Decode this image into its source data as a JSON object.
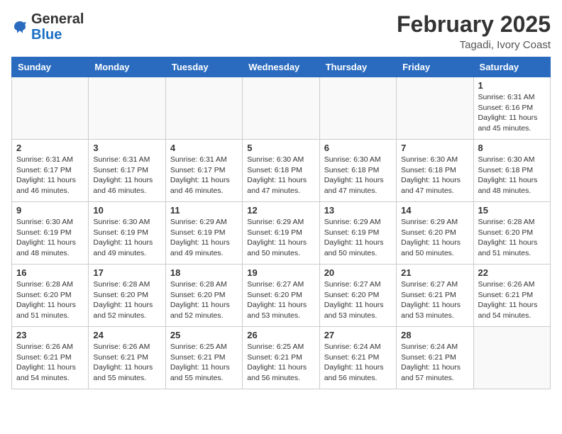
{
  "logo": {
    "general": "General",
    "blue": "Blue"
  },
  "title": {
    "month_year": "February 2025",
    "location": "Tagadi, Ivory Coast"
  },
  "days_of_week": [
    "Sunday",
    "Monday",
    "Tuesday",
    "Wednesday",
    "Thursday",
    "Friday",
    "Saturday"
  ],
  "weeks": [
    [
      {
        "day": "",
        "info": ""
      },
      {
        "day": "",
        "info": ""
      },
      {
        "day": "",
        "info": ""
      },
      {
        "day": "",
        "info": ""
      },
      {
        "day": "",
        "info": ""
      },
      {
        "day": "",
        "info": ""
      },
      {
        "day": "1",
        "info": "Sunrise: 6:31 AM\nSunset: 6:16 PM\nDaylight: 11 hours and 45 minutes."
      }
    ],
    [
      {
        "day": "2",
        "info": "Sunrise: 6:31 AM\nSunset: 6:17 PM\nDaylight: 11 hours and 46 minutes."
      },
      {
        "day": "3",
        "info": "Sunrise: 6:31 AM\nSunset: 6:17 PM\nDaylight: 11 hours and 46 minutes."
      },
      {
        "day": "4",
        "info": "Sunrise: 6:31 AM\nSunset: 6:17 PM\nDaylight: 11 hours and 46 minutes."
      },
      {
        "day": "5",
        "info": "Sunrise: 6:30 AM\nSunset: 6:18 PM\nDaylight: 11 hours and 47 minutes."
      },
      {
        "day": "6",
        "info": "Sunrise: 6:30 AM\nSunset: 6:18 PM\nDaylight: 11 hours and 47 minutes."
      },
      {
        "day": "7",
        "info": "Sunrise: 6:30 AM\nSunset: 6:18 PM\nDaylight: 11 hours and 47 minutes."
      },
      {
        "day": "8",
        "info": "Sunrise: 6:30 AM\nSunset: 6:18 PM\nDaylight: 11 hours and 48 minutes."
      }
    ],
    [
      {
        "day": "9",
        "info": "Sunrise: 6:30 AM\nSunset: 6:19 PM\nDaylight: 11 hours and 48 minutes."
      },
      {
        "day": "10",
        "info": "Sunrise: 6:30 AM\nSunset: 6:19 PM\nDaylight: 11 hours and 49 minutes."
      },
      {
        "day": "11",
        "info": "Sunrise: 6:29 AM\nSunset: 6:19 PM\nDaylight: 11 hours and 49 minutes."
      },
      {
        "day": "12",
        "info": "Sunrise: 6:29 AM\nSunset: 6:19 PM\nDaylight: 11 hours and 50 minutes."
      },
      {
        "day": "13",
        "info": "Sunrise: 6:29 AM\nSunset: 6:19 PM\nDaylight: 11 hours and 50 minutes."
      },
      {
        "day": "14",
        "info": "Sunrise: 6:29 AM\nSunset: 6:20 PM\nDaylight: 11 hours and 50 minutes."
      },
      {
        "day": "15",
        "info": "Sunrise: 6:28 AM\nSunset: 6:20 PM\nDaylight: 11 hours and 51 minutes."
      }
    ],
    [
      {
        "day": "16",
        "info": "Sunrise: 6:28 AM\nSunset: 6:20 PM\nDaylight: 11 hours and 51 minutes."
      },
      {
        "day": "17",
        "info": "Sunrise: 6:28 AM\nSunset: 6:20 PM\nDaylight: 11 hours and 52 minutes."
      },
      {
        "day": "18",
        "info": "Sunrise: 6:28 AM\nSunset: 6:20 PM\nDaylight: 11 hours and 52 minutes."
      },
      {
        "day": "19",
        "info": "Sunrise: 6:27 AM\nSunset: 6:20 PM\nDaylight: 11 hours and 53 minutes."
      },
      {
        "day": "20",
        "info": "Sunrise: 6:27 AM\nSunset: 6:20 PM\nDaylight: 11 hours and 53 minutes."
      },
      {
        "day": "21",
        "info": "Sunrise: 6:27 AM\nSunset: 6:21 PM\nDaylight: 11 hours and 53 minutes."
      },
      {
        "day": "22",
        "info": "Sunrise: 6:26 AM\nSunset: 6:21 PM\nDaylight: 11 hours and 54 minutes."
      }
    ],
    [
      {
        "day": "23",
        "info": "Sunrise: 6:26 AM\nSunset: 6:21 PM\nDaylight: 11 hours and 54 minutes."
      },
      {
        "day": "24",
        "info": "Sunrise: 6:26 AM\nSunset: 6:21 PM\nDaylight: 11 hours and 55 minutes."
      },
      {
        "day": "25",
        "info": "Sunrise: 6:25 AM\nSunset: 6:21 PM\nDaylight: 11 hours and 55 minutes."
      },
      {
        "day": "26",
        "info": "Sunrise: 6:25 AM\nSunset: 6:21 PM\nDaylight: 11 hours and 56 minutes."
      },
      {
        "day": "27",
        "info": "Sunrise: 6:24 AM\nSunset: 6:21 PM\nDaylight: 11 hours and 56 minutes."
      },
      {
        "day": "28",
        "info": "Sunrise: 6:24 AM\nSunset: 6:21 PM\nDaylight: 11 hours and 57 minutes."
      },
      {
        "day": "",
        "info": ""
      }
    ]
  ]
}
